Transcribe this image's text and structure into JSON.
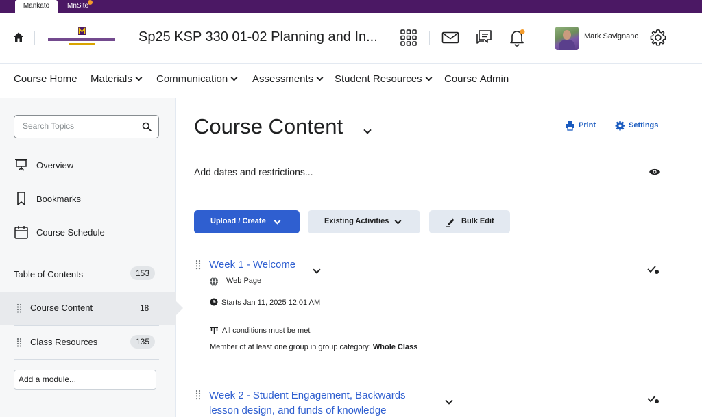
{
  "browser_tabs": [
    {
      "label": "Mankato",
      "active": true
    },
    {
      "label": "MnSite",
      "active": false
    }
  ],
  "header": {
    "logo_text": "Minnesota State University",
    "course_title": "Sp25 KSP 330 01-02 Planning and In...",
    "user_name": "Mark Savignano",
    "icons": [
      "home-icon",
      "grid-icon",
      "mail-icon",
      "chat-icon",
      "bell-icon",
      "gear-icon"
    ]
  },
  "nav": {
    "items": [
      {
        "label": "Course Home",
        "dropdown": false
      },
      {
        "label": "Materials",
        "dropdown": true
      },
      {
        "label": "Communication",
        "dropdown": true
      },
      {
        "label": "Assessments",
        "dropdown": true
      },
      {
        "label": "Student Resources",
        "dropdown": true
      },
      {
        "label": "Course Admin",
        "dropdown": false
      }
    ]
  },
  "sidebar": {
    "search_placeholder": "Search Topics",
    "links": [
      {
        "label": "Overview",
        "icon": "presentation-icon"
      },
      {
        "label": "Bookmarks",
        "icon": "bookmark-icon"
      },
      {
        "label": "Course Schedule",
        "icon": "calendar-icon"
      }
    ],
    "toc": {
      "label": "Table of Contents",
      "count": "153"
    },
    "modules": [
      {
        "label": "Course Content",
        "count": "18",
        "active": true
      },
      {
        "label": "Class Resources",
        "count": "135",
        "active": false
      }
    ],
    "add_module_placeholder": "Add a module..."
  },
  "main": {
    "title": "Course Content",
    "print_label": "Print",
    "settings_label": "Settings",
    "dates_link": "Add dates and restrictions...",
    "buttons": {
      "upload": "Upload / Create",
      "existing": "Existing Activities",
      "bulk": "Bulk Edit"
    },
    "topics": [
      {
        "title": "Week 1 - Welcome",
        "type": "Web Page",
        "starts": "Starts Jan 11, 2025 12:01 AM",
        "conditions": "All conditions must be met",
        "restriction_prefix": "Member of at least one group in group category:",
        "restriction_group": "Whole Class"
      },
      {
        "title": "Week 2 - Student Engagement, Backwards lesson design, and funds of knowledge"
      }
    ]
  },
  "colors": {
    "top_bar": "#4b1864",
    "link_blue": "#2f5fd0",
    "primary_button": "#2f5fd0",
    "secondary_button": "#e3e9f1",
    "notification_dot": "#f39b2b"
  }
}
